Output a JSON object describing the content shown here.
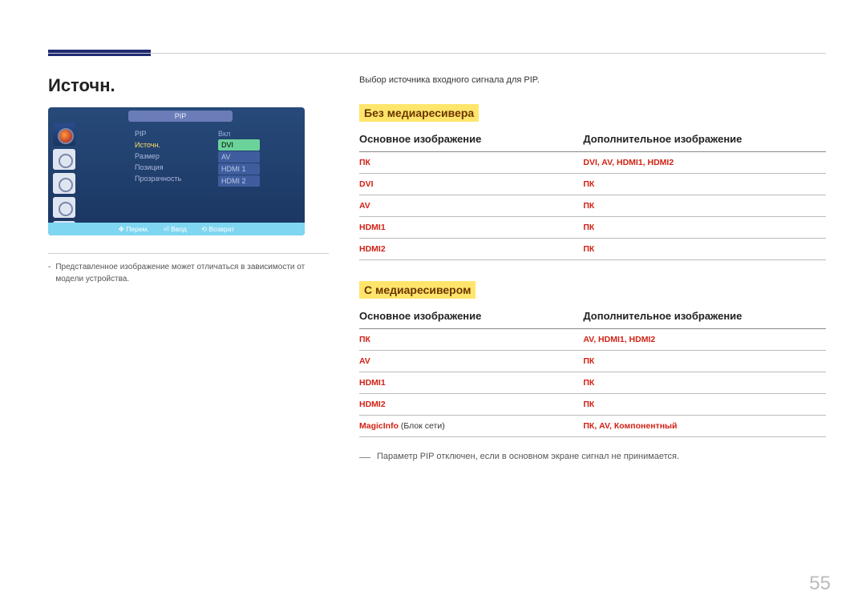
{
  "page_number": "55",
  "section_title": "Источн.",
  "caption": "Представленное изображение может отличаться в зависимости от модели устройства.",
  "intro": "Выбор источника входного сигнала для PIP.",
  "osd": {
    "title": "PIP",
    "items": [
      "PIP",
      "Источн.",
      "Размер",
      "Позиция",
      "Прозрачность"
    ],
    "value_on": "Вкл",
    "opts": [
      "DVI",
      "AV",
      "HDMI 1",
      "HDMI 2"
    ],
    "footer": {
      "move": "Перем.",
      "enter": "Ввод",
      "return": "Возврат"
    }
  },
  "group1": {
    "heading": "Без медиаресивера",
    "col1": "Основное изображение",
    "col2": "Дополнительное изображение",
    "rows": [
      {
        "main": "ПК",
        "sub": "DVI, AV, HDMI1, HDMI2"
      },
      {
        "main": "DVI",
        "sub": "ПК"
      },
      {
        "main": "AV",
        "sub": "ПК"
      },
      {
        "main": "HDMI1",
        "sub": "ПК"
      },
      {
        "main": "HDMI2",
        "sub": "ПК"
      }
    ]
  },
  "group2": {
    "heading": "С медиаресивером",
    "col1": "Основное изображение",
    "col2": "Дополнительное изображение",
    "rows": [
      {
        "main": "ПК",
        "sub": "AV, HDMI1, HDMI2"
      },
      {
        "main": "AV",
        "sub": "ПК"
      },
      {
        "main": "HDMI1",
        "sub": "ПК"
      },
      {
        "main": "HDMI2",
        "sub": "ПК"
      },
      {
        "main_pre": "MagicInfo",
        "main_plain": " (Блок сети)",
        "sub": "ПК, AV, Компонентный"
      }
    ]
  },
  "footnote": "Параметр PIP отключен, если в основном экране сигнал не принимается."
}
